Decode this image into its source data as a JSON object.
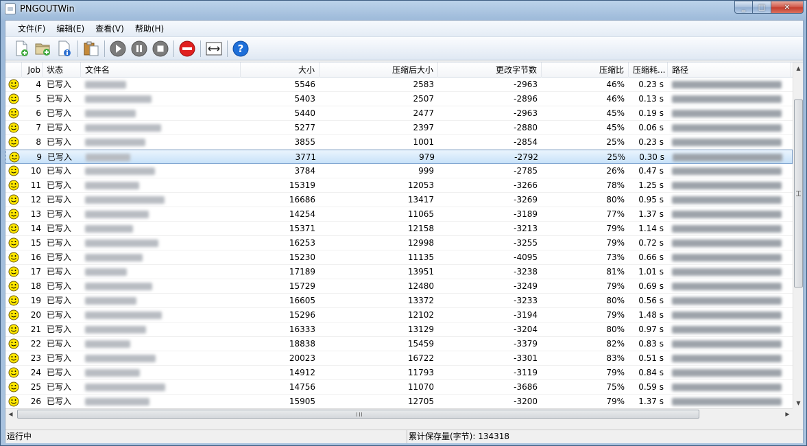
{
  "window": {
    "title": "PNGOUTWin"
  },
  "menu": [
    "文件(F)",
    "编辑(E)",
    "查看(V)",
    "帮助(H)"
  ],
  "toolbar": {
    "buttons": [
      {
        "name": "add-file-icon"
      },
      {
        "name": "add-folder-icon"
      },
      {
        "name": "file-info-icon"
      },
      {
        "name": "clipboard-icon"
      },
      {
        "name": "play-icon"
      },
      {
        "name": "pause-icon"
      },
      {
        "name": "stop-icon"
      },
      {
        "name": "cancel-icon"
      },
      {
        "name": "fit-columns-icon"
      },
      {
        "name": "help-icon"
      }
    ]
  },
  "columns": [
    "Job",
    "状态",
    "文件名",
    "大小",
    "压缩后大小",
    "更改字节数",
    "压缩比",
    "压缩耗...",
    "路径"
  ],
  "rows": [
    [
      "4",
      "已写入",
      "",
      "5546",
      "2583",
      "-2963",
      "46%",
      "0.23 s",
      ""
    ],
    [
      "5",
      "已写入",
      "",
      "5403",
      "2507",
      "-2896",
      "46%",
      "0.13 s",
      ""
    ],
    [
      "6",
      "已写入",
      "",
      "5440",
      "2477",
      "-2963",
      "45%",
      "0.19 s",
      ""
    ],
    [
      "7",
      "已写入",
      "",
      "5277",
      "2397",
      "-2880",
      "45%",
      "0.06 s",
      ""
    ],
    [
      "8",
      "已写入",
      "",
      "3855",
      "1001",
      "-2854",
      "25%",
      "0.23 s",
      ""
    ],
    [
      "9",
      "已写入",
      "",
      "3771",
      "979",
      "-2792",
      "25%",
      "0.30 s",
      ""
    ],
    [
      "10",
      "已写入",
      "",
      "3784",
      "999",
      "-2785",
      "26%",
      "0.47 s",
      ""
    ],
    [
      "11",
      "已写入",
      "",
      "15319",
      "12053",
      "-3266",
      "78%",
      "1.25 s",
      ""
    ],
    [
      "12",
      "已写入",
      "",
      "16686",
      "13417",
      "-3269",
      "80%",
      "0.95 s",
      ""
    ],
    [
      "13",
      "已写入",
      "",
      "14254",
      "11065",
      "-3189",
      "77%",
      "1.37 s",
      ""
    ],
    [
      "14",
      "已写入",
      "",
      "15371",
      "12158",
      "-3213",
      "79%",
      "1.14 s",
      ""
    ],
    [
      "15",
      "已写入",
      "",
      "16253",
      "12998",
      "-3255",
      "79%",
      "0.72 s",
      ""
    ],
    [
      "16",
      "已写入",
      "",
      "15230",
      "11135",
      "-4095",
      "73%",
      "0.66 s",
      ""
    ],
    [
      "17",
      "已写入",
      "",
      "17189",
      "13951",
      "-3238",
      "81%",
      "1.01 s",
      ""
    ],
    [
      "18",
      "已写入",
      "",
      "15729",
      "12480",
      "-3249",
      "79%",
      "0.69 s",
      ""
    ],
    [
      "19",
      "已写入",
      "",
      "16605",
      "13372",
      "-3233",
      "80%",
      "0.56 s",
      ""
    ],
    [
      "20",
      "已写入",
      "",
      "15296",
      "12102",
      "-3194",
      "79%",
      "1.48 s",
      ""
    ],
    [
      "21",
      "已写入",
      "",
      "16333",
      "13129",
      "-3204",
      "80%",
      "0.97 s",
      ""
    ],
    [
      "22",
      "已写入",
      "",
      "18838",
      "15459",
      "-3379",
      "82%",
      "0.83 s",
      ""
    ],
    [
      "23",
      "已写入",
      "",
      "20023",
      "16722",
      "-3301",
      "83%",
      "0.51 s",
      ""
    ],
    [
      "24",
      "已写入",
      "",
      "14912",
      "11793",
      "-3119",
      "79%",
      "0.84 s",
      ""
    ],
    [
      "25",
      "已写入",
      "",
      "14756",
      "11070",
      "-3686",
      "75%",
      "0.59 s",
      ""
    ],
    [
      "26",
      "已写入",
      "",
      "15905",
      "12705",
      "-3200",
      "79%",
      "1.37 s",
      ""
    ]
  ],
  "selected_job": "9",
  "status": {
    "left": "运行中",
    "right": "累计保存量(字节): 134318"
  }
}
